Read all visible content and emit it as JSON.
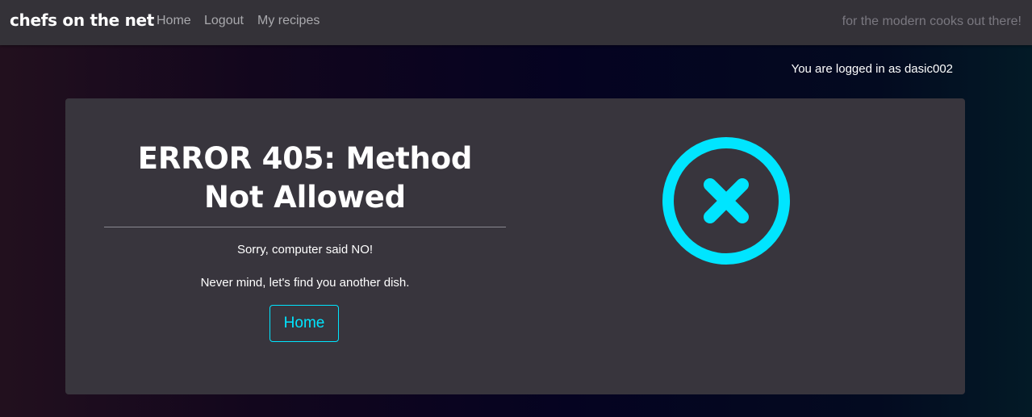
{
  "nav": {
    "brand": "chefs on the net",
    "links": [
      "Home",
      "Logout",
      "My recipes"
    ],
    "tagline": "for the modern cooks out there!"
  },
  "status": {
    "login_text": "You are logged in as dasic002"
  },
  "error": {
    "title": "ERROR 405: Method Not Allowed",
    "message": "Sorry, computer said NO!",
    "submessage": "Never mind, let's find you another dish.",
    "home_button": "Home"
  },
  "icons": {
    "error": "x-circle-icon"
  },
  "colors": {
    "accent": "#00e5ff",
    "navbar": "#343238",
    "card": "#38353d"
  }
}
